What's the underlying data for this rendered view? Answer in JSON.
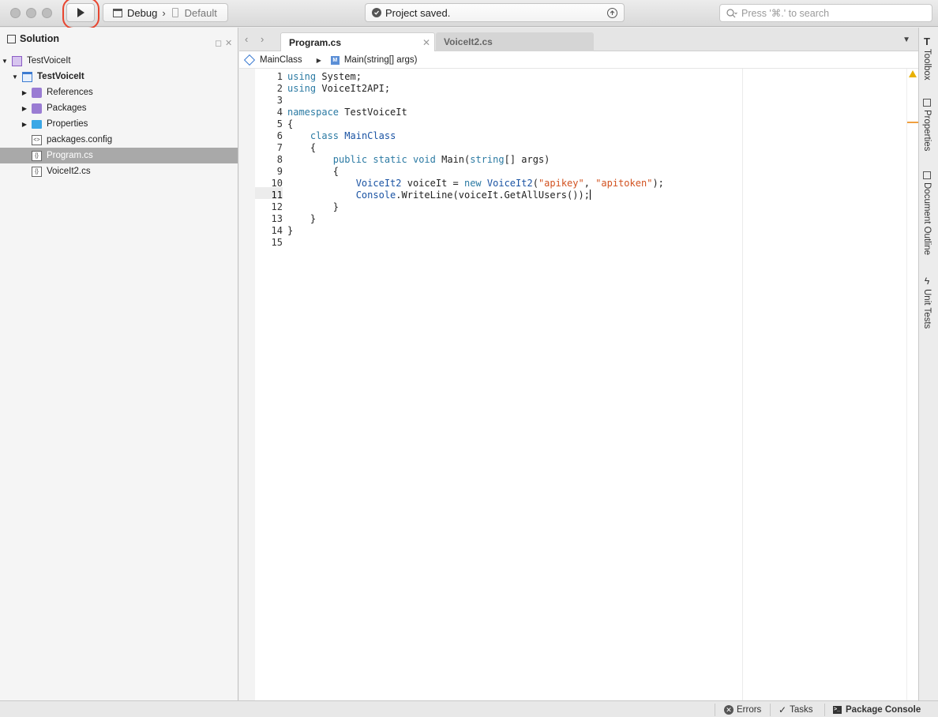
{
  "toolbar": {
    "configuration": "Debug",
    "target": "Default",
    "status_text": "Project saved.",
    "search_placeholder": "Press '⌘.' to search"
  },
  "solution": {
    "title": "Solution",
    "tree": [
      {
        "label": "TestVoiceIt",
        "icon": "solution-icon",
        "expanded": true,
        "level": 0
      },
      {
        "label": "TestVoiceIt",
        "icon": "project-icon",
        "expanded": true,
        "level": 1,
        "bold": true
      },
      {
        "label": "References",
        "icon": "references-icon",
        "expanded": false,
        "level": 2
      },
      {
        "label": "Packages",
        "icon": "packages-icon",
        "expanded": false,
        "level": 2
      },
      {
        "label": "Properties",
        "icon": "folder-icon",
        "expanded": false,
        "level": 2
      },
      {
        "label": "packages.config",
        "icon": "config-file-icon",
        "level": 2
      },
      {
        "label": "Program.cs",
        "icon": "cs-file-icon",
        "level": 2,
        "selected": true
      },
      {
        "label": "VoiceIt2.cs",
        "icon": "cs-file-icon",
        "level": 2
      }
    ]
  },
  "editor": {
    "tabs": [
      {
        "label": "Program.cs",
        "active": true
      },
      {
        "label": "VoiceIt2.cs",
        "active": false
      }
    ],
    "breadcrumb": {
      "class_name": "MainClass",
      "method_name": "Main(string[] args)"
    },
    "current_line": 11,
    "lines": [
      {
        "n": "1",
        "text": "using System;"
      },
      {
        "n": "2",
        "text": "using VoiceIt2API;"
      },
      {
        "n": "3",
        "text": ""
      },
      {
        "n": "4",
        "text": "namespace TestVoiceIt"
      },
      {
        "n": "5",
        "text": "{"
      },
      {
        "n": "6",
        "text": "    class MainClass"
      },
      {
        "n": "7",
        "text": "    {"
      },
      {
        "n": "8",
        "text": "        public static void Main(string[] args)"
      },
      {
        "n": "9",
        "text": "        {"
      },
      {
        "n": "10",
        "text": "            VoiceIt2 voiceIt = new VoiceIt2(\"apikey\", \"apitoken\");"
      },
      {
        "n": "11",
        "text": "            Console.WriteLine(voiceIt.GetAllUsers());"
      },
      {
        "n": "12",
        "text": "        }"
      },
      {
        "n": "13",
        "text": "    }"
      },
      {
        "n": "14",
        "text": "}"
      },
      {
        "n": "15",
        "text": ""
      }
    ]
  },
  "dock": {
    "items": [
      {
        "label": "Toolbox",
        "icon": "toolbox-icon"
      },
      {
        "label": "Properties",
        "icon": "properties-icon"
      },
      {
        "label": "Document Outline",
        "icon": "outline-icon"
      },
      {
        "label": "Unit Tests",
        "icon": "unit-tests-icon"
      }
    ]
  },
  "statusbar": {
    "errors_label": "Errors",
    "tasks_label": "Tasks",
    "console_label": "Package Console"
  },
  "colors": {
    "keyword": "#2b7aa3",
    "type": "#1a53a3",
    "string": "#d2511f",
    "highlight_ring": "#e8452f",
    "selection": "#a9a9a9"
  }
}
